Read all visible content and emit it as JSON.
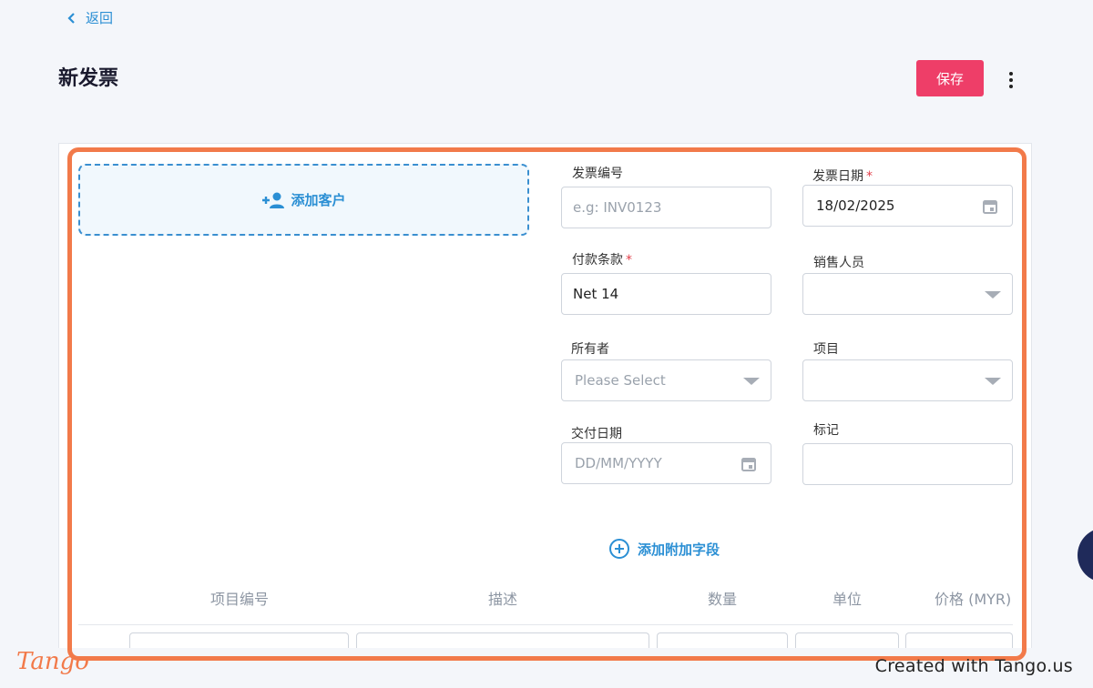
{
  "nav": {
    "back_label": "返回"
  },
  "header": {
    "title": "新发票",
    "save_label": "保存"
  },
  "customer": {
    "add_label": "添加客户"
  },
  "form": {
    "invoice_number": {
      "label": "发票编号",
      "placeholder": "e.g: INV0123",
      "value": ""
    },
    "invoice_date": {
      "label": "发票日期",
      "required": "*",
      "value": "18/02/2025"
    },
    "payment_terms": {
      "label": "付款条款",
      "required": "*",
      "value": "Net 14"
    },
    "salesperson": {
      "label": "销售人员",
      "value": ""
    },
    "owner": {
      "label": "所有者",
      "placeholder": "Please Select"
    },
    "project": {
      "label": "项目",
      "value": ""
    },
    "delivery_date": {
      "label": "交付日期",
      "placeholder": "DD/MM/YYYY"
    },
    "tags": {
      "label": "标记",
      "value": ""
    }
  },
  "add_extra_field_label": "添加附加字段",
  "table": {
    "columns": [
      "项目编号",
      "描述",
      "数量",
      "单位",
      "价格 (MYR)"
    ]
  },
  "footer": {
    "logo_text": "Tango",
    "credit": "Created with Tango.us"
  },
  "colors": {
    "accent": "#2b8fd4",
    "save_button": "#ee3e68",
    "highlight": "#f27a4a"
  }
}
